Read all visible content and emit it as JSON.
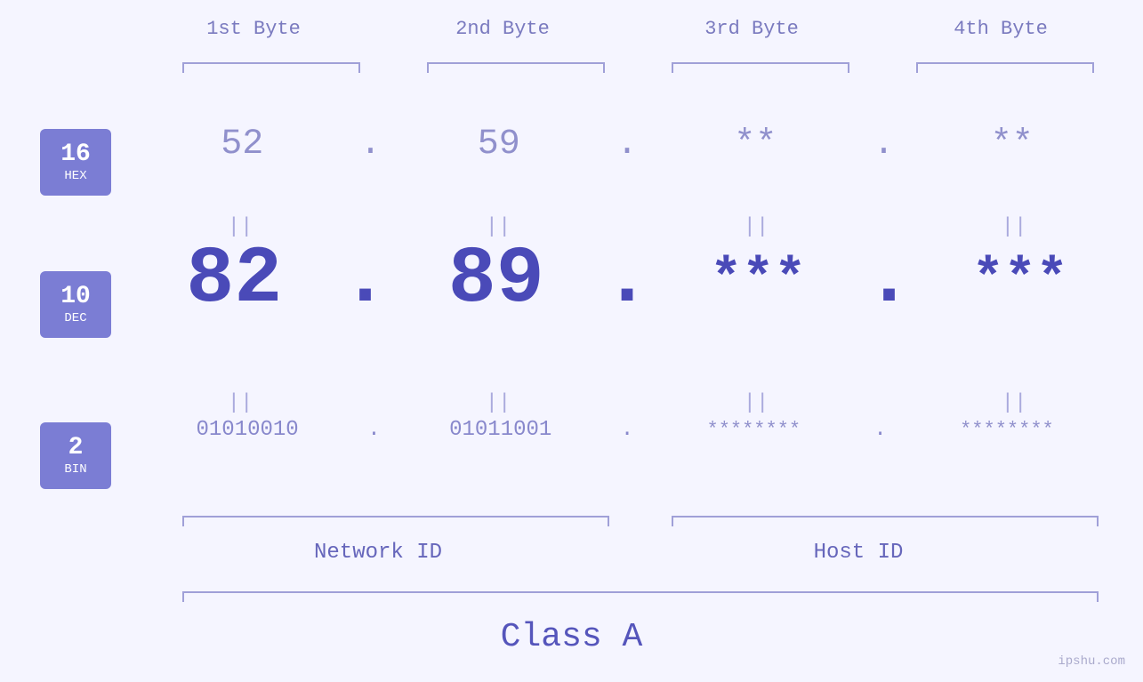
{
  "bytes": {
    "headers": [
      "1st Byte",
      "2nd Byte",
      "3rd Byte",
      "4th Byte"
    ],
    "hex": [
      "52",
      "59",
      "**",
      "**"
    ],
    "dec": [
      "82",
      "89",
      "***",
      "***"
    ],
    "bin": [
      "01010010",
      "01011001",
      "********",
      "********"
    ],
    "dots": [
      ".",
      ".",
      ".",
      "."
    ]
  },
  "badges": [
    {
      "number": "16",
      "label": "HEX"
    },
    {
      "number": "10",
      "label": "DEC"
    },
    {
      "number": "2",
      "label": "BIN"
    }
  ],
  "labels": {
    "networkId": "Network ID",
    "hostId": "Host ID",
    "classA": "Class A",
    "watermark": "ipshu.com"
  },
  "colors": {
    "badge_bg": "#7b7dd4",
    "hex_color": "#9090cc",
    "dec_color": "#4a4ab8",
    "bin_color": "#8888cc",
    "label_color": "#6666bb",
    "bracket_color": "#a0a0d8",
    "header_color": "#7a7abf"
  }
}
